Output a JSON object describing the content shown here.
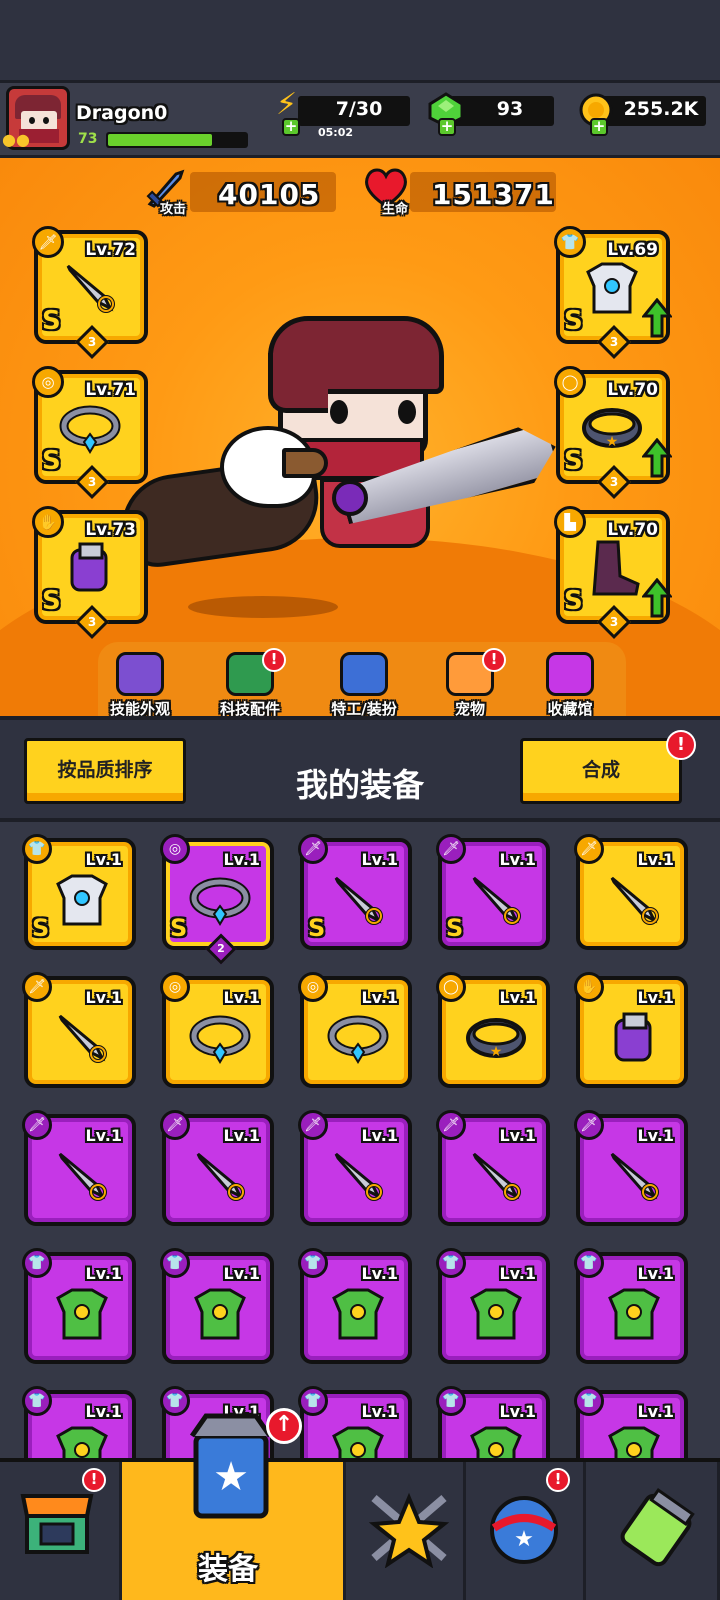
{
  "player": {
    "name": "Dragon0",
    "level": "73",
    "xp_fraction": 0.75
  },
  "resources": {
    "energy": "7/30",
    "energy_timer": "05:02",
    "gems": "93",
    "coins": "255.2K"
  },
  "stats": {
    "attack_label": "攻击",
    "attack_value": "40105",
    "hp_label": "生命",
    "hp_value": "151371"
  },
  "equipped": {
    "left": [
      {
        "type": "weapon",
        "level": "Lv.72",
        "grade": "S",
        "stars": "3"
      },
      {
        "type": "necklace",
        "level": "Lv.71",
        "grade": "S",
        "stars": "3"
      },
      {
        "type": "glove",
        "level": "Lv.73",
        "grade": "S",
        "stars": "3"
      }
    ],
    "right": [
      {
        "type": "armor",
        "level": "Lv.69",
        "grade": "S",
        "stars": "3",
        "upgrade": true
      },
      {
        "type": "belt",
        "level": "Lv.70",
        "grade": "S",
        "stars": "3",
        "upgrade": true
      },
      {
        "type": "boots",
        "level": "Lv.70",
        "grade": "S",
        "stars": "3",
        "upgrade": true
      }
    ]
  },
  "hero_menu": [
    {
      "label": "技能外观",
      "icon": "skill-skin-icon",
      "alert": false
    },
    {
      "label": "科技配件",
      "icon": "tech-parts-icon",
      "alert": true
    },
    {
      "label": "特工/装扮",
      "icon": "agent-costume-icon",
      "alert": false
    },
    {
      "label": "宠物",
      "icon": "pet-icon",
      "alert": true
    },
    {
      "label": "收藏馆",
      "icon": "collection-icon",
      "alert": false
    }
  ],
  "equipment_section": {
    "sort_button": "按品质排序",
    "title": "我的装备",
    "merge_button": "合成",
    "merge_alert": "!"
  },
  "inventory": [
    {
      "rarity": "gold",
      "type": "armor",
      "level": "Lv.1",
      "grade": "S",
      "stars": ""
    },
    {
      "rarity": "purple-gold",
      "type": "necklace",
      "level": "Lv.1",
      "grade": "S",
      "stars": "2"
    },
    {
      "rarity": "purple",
      "type": "weapon",
      "level": "Lv.1",
      "grade": "S",
      "stars": ""
    },
    {
      "rarity": "purple",
      "type": "weapon",
      "level": "Lv.1",
      "grade": "S",
      "stars": ""
    },
    {
      "rarity": "gold",
      "type": "weapon",
      "level": "Lv.1",
      "grade": "",
      "stars": ""
    },
    {
      "rarity": "gold",
      "type": "weapon",
      "level": "Lv.1",
      "grade": "",
      "stars": ""
    },
    {
      "rarity": "gold",
      "type": "necklace",
      "level": "Lv.1",
      "grade": "",
      "stars": ""
    },
    {
      "rarity": "gold",
      "type": "necklace",
      "level": "Lv.1",
      "grade": "",
      "stars": ""
    },
    {
      "rarity": "gold",
      "type": "belt",
      "level": "Lv.1",
      "grade": "",
      "stars": ""
    },
    {
      "rarity": "gold",
      "type": "glove",
      "level": "Lv.1",
      "grade": "",
      "stars": ""
    },
    {
      "rarity": "purple",
      "type": "weapon",
      "level": "Lv.1",
      "grade": "",
      "stars": ""
    },
    {
      "rarity": "purple",
      "type": "weapon",
      "level": "Lv.1",
      "grade": "",
      "stars": ""
    },
    {
      "rarity": "purple",
      "type": "weapon",
      "level": "Lv.1",
      "grade": "",
      "stars": ""
    },
    {
      "rarity": "purple",
      "type": "weapon",
      "level": "Lv.1",
      "grade": "",
      "stars": ""
    },
    {
      "rarity": "purple",
      "type": "weapon",
      "level": "Lv.1",
      "grade": "",
      "stars": ""
    },
    {
      "rarity": "purple",
      "type": "armor",
      "level": "Lv.1",
      "grade": "",
      "stars": ""
    },
    {
      "rarity": "purple",
      "type": "armor",
      "level": "Lv.1",
      "grade": "",
      "stars": ""
    },
    {
      "rarity": "purple",
      "type": "armor",
      "level": "Lv.1",
      "grade": "",
      "stars": ""
    },
    {
      "rarity": "purple",
      "type": "armor",
      "level": "Lv.1",
      "grade": "",
      "stars": ""
    },
    {
      "rarity": "purple",
      "type": "armor",
      "level": "Lv.1",
      "grade": "",
      "stars": ""
    },
    {
      "rarity": "purple",
      "type": "armor",
      "level": "Lv.1",
      "grade": "",
      "stars": ""
    },
    {
      "rarity": "purple",
      "type": "armor",
      "level": "Lv.1",
      "grade": "",
      "stars": ""
    },
    {
      "rarity": "purple",
      "type": "armor",
      "level": "Lv.1",
      "grade": "",
      "stars": ""
    },
    {
      "rarity": "purple",
      "type": "armor",
      "level": "Lv.1",
      "grade": "",
      "stars": ""
    },
    {
      "rarity": "purple",
      "type": "armor",
      "level": "Lv.1",
      "grade": "",
      "stars": ""
    }
  ],
  "bottom_nav": [
    {
      "name": "shop",
      "icon": "shop-icon",
      "alert": true,
      "label": ""
    },
    {
      "name": "equipment",
      "icon": "equipment-icon",
      "alert": false,
      "label": "装备",
      "active": true
    },
    {
      "name": "battle",
      "icon": "battle-star-icon",
      "alert": false,
      "label": ""
    },
    {
      "name": "events",
      "icon": "egg-icon",
      "alert": true,
      "label": ""
    },
    {
      "name": "lab",
      "icon": "dna-capsule-icon",
      "alert": false,
      "label": ""
    }
  ],
  "colors": {
    "gold": "#ffd21e",
    "purple": "#c637e6",
    "orange_bg": "#ff9a14",
    "alert": "#e8192c",
    "upgrade_green": "#3ec22a"
  }
}
